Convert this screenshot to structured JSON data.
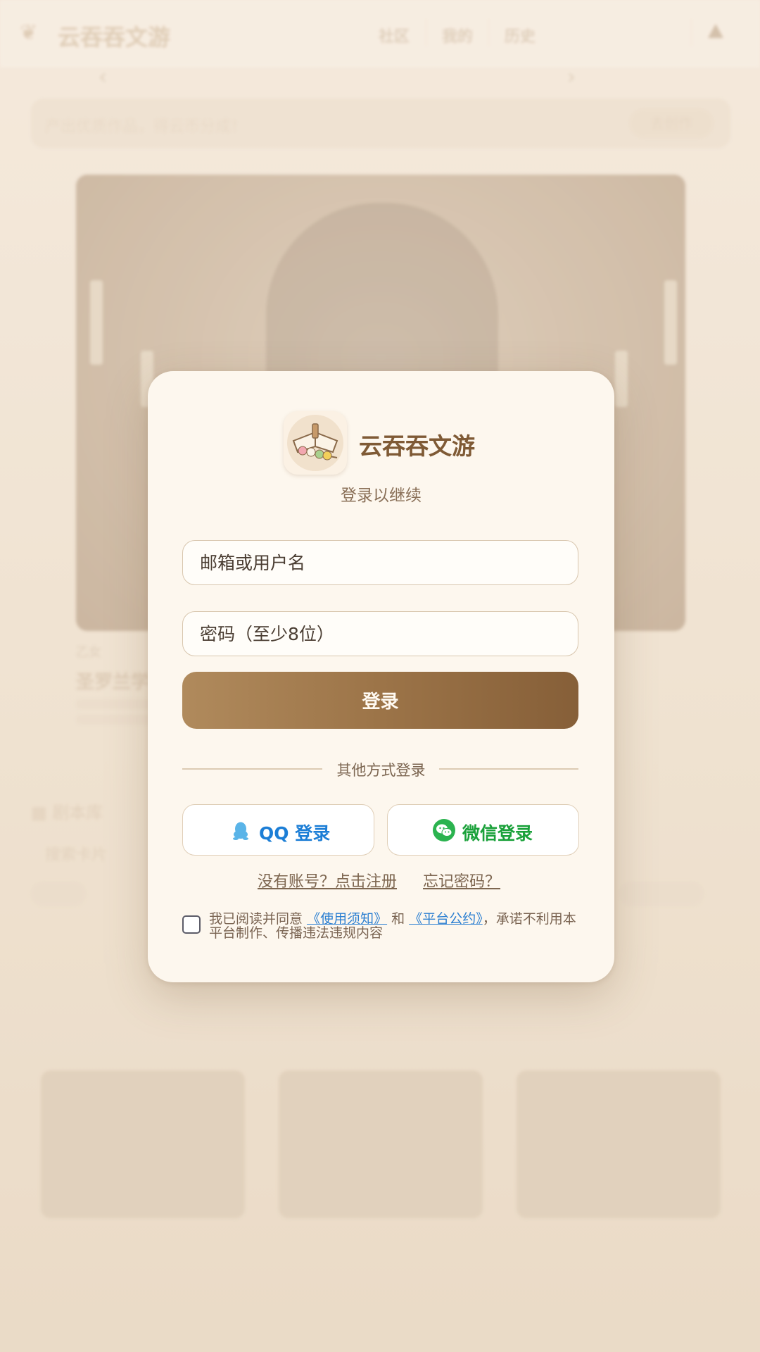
{
  "header": {
    "app_title": "云吞吞文游",
    "tabs": [
      "社区",
      "我的",
      "历史"
    ]
  },
  "banner": {
    "text": "产出优质作品，得云币分成！",
    "button": "去创作"
  },
  "featured": {
    "tag": "乙女",
    "title": "圣罗兰学"
  },
  "library": {
    "heading": "剧本库",
    "search_placeholder": "搜索卡片"
  },
  "login": {
    "brand_title": "云吞吞文游",
    "subtitle": "登录以继续",
    "username_placeholder": "邮箱或用户名",
    "password_placeholder": "密码（至少8位）",
    "submit_label": "登录",
    "divider_text": "其他方式登录",
    "qq_label": "QQ 登录",
    "wechat_label": "微信登录",
    "register_link": "没有账号？点击注册",
    "forgot_link": "忘记密码？",
    "agreement": {
      "prefix": "我已阅读并同意",
      "terms": "《使用须知》",
      "and": "和",
      "convention": "《平台公约》",
      "suffix": "，承诺不利用本平台制作、传播违法违规内容"
    }
  },
  "colors": {
    "accent_brown": "#9c7448",
    "qq_blue": "#1c7ed6",
    "wechat_green": "#1aa13a",
    "link_blue": "#2b7fd1"
  }
}
